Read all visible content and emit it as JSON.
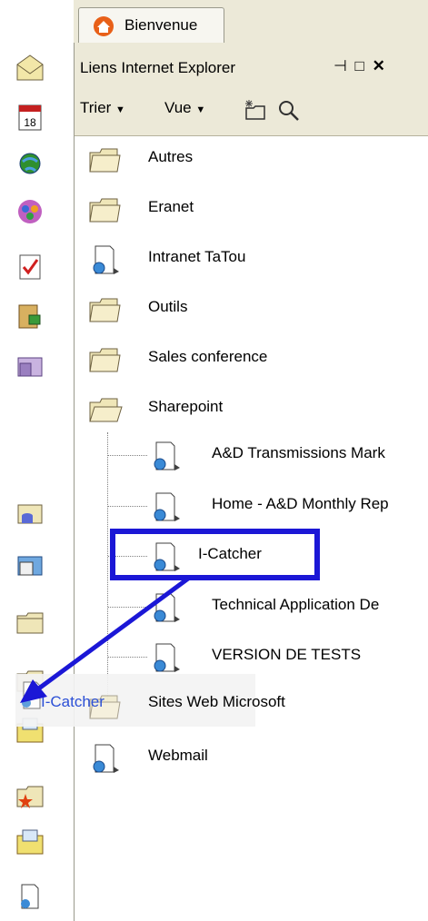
{
  "tab": {
    "label": "Bienvenue"
  },
  "panel": {
    "title": "Liens Internet Explorer",
    "pin_icon": "pin-icon",
    "restore_icon": "restore-icon",
    "close_icon": "close-icon",
    "close_glyph": "✕",
    "restore_glyph": "□",
    "pin_glyph": "⊣"
  },
  "toolbar": {
    "sort_label": "Trier",
    "view_label": "Vue",
    "arrow": "▼"
  },
  "tree": {
    "items": [
      {
        "label": "Autres",
        "icon": "folder-icon"
      },
      {
        "label": "Eranet",
        "icon": "folder-icon"
      },
      {
        "label": "Intranet TaTou",
        "icon": "web-link-icon"
      },
      {
        "label": "Outils",
        "icon": "folder-icon"
      },
      {
        "label": "Sales conference",
        "icon": "folder-icon"
      },
      {
        "label": "Sharepoint",
        "icon": "folder-open-icon"
      },
      {
        "label": "A&D Transmissions Mark",
        "icon": "web-link-icon"
      },
      {
        "label": "Home - A&D Monthly Rep",
        "icon": "web-link-icon"
      },
      {
        "label": "I-Catcher",
        "icon": "web-link-icon"
      },
      {
        "label": "Technical Application De",
        "icon": "web-link-icon"
      },
      {
        "label": "VERSION DE TESTS",
        "icon": "web-link-icon"
      },
      {
        "label": "Sites Web Microsoft",
        "icon": "folder-icon"
      },
      {
        "label": "Webmail",
        "icon": "web-link-icon"
      }
    ]
  },
  "drag": {
    "label": "I-Catcher"
  },
  "colors": {
    "highlight": "#1b17d6",
    "arrow": "#1b17d6",
    "chrome": "#ece9d8"
  }
}
